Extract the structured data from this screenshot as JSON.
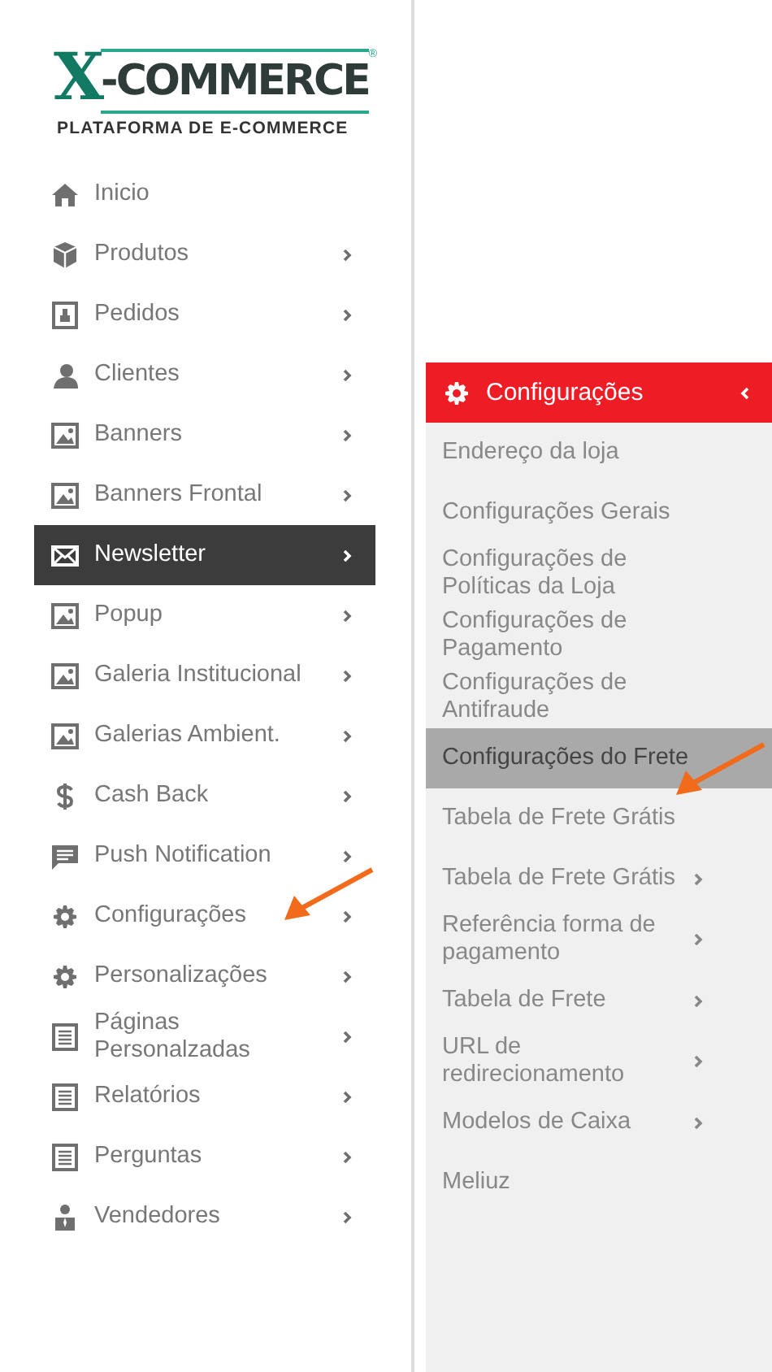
{
  "logo": {
    "mark": "X",
    "word": "-COMMERCE",
    "registered": "®",
    "tagline": "PLATAFORMA DE E-COMMERCE"
  },
  "sidebar": {
    "items": [
      {
        "label": "Inicio",
        "kind": "home",
        "has_children": false,
        "selected": false,
        "marked": false
      },
      {
        "label": "Produtos",
        "kind": "box",
        "has_children": true,
        "selected": false,
        "marked": false
      },
      {
        "label": "Pedidos",
        "kind": "clipboard",
        "has_children": true,
        "selected": false,
        "marked": false
      },
      {
        "label": "Clientes",
        "kind": "user",
        "has_children": true,
        "selected": false,
        "marked": false
      },
      {
        "label": "Banners",
        "kind": "image",
        "has_children": true,
        "selected": false,
        "marked": false
      },
      {
        "label": "Banners Frontal",
        "kind": "image",
        "has_children": true,
        "selected": false,
        "marked": false
      },
      {
        "label": "Newsletter",
        "kind": "mail",
        "has_children": true,
        "selected": true,
        "marked": false
      },
      {
        "label": "Popup",
        "kind": "image",
        "has_children": true,
        "selected": false,
        "marked": false
      },
      {
        "label": "Galeria Institucional",
        "kind": "image",
        "has_children": true,
        "selected": false,
        "marked": false
      },
      {
        "label": "Galerias Ambient.",
        "kind": "image",
        "has_children": true,
        "selected": false,
        "marked": false
      },
      {
        "label": "Cash Back",
        "kind": "dollar",
        "has_children": true,
        "selected": false,
        "marked": false
      },
      {
        "label": "Push Notification",
        "kind": "chat",
        "has_children": true,
        "selected": false,
        "marked": false
      },
      {
        "label": "Configurações",
        "kind": "gear",
        "has_children": true,
        "selected": false,
        "marked": true
      },
      {
        "label": "Personalizações",
        "kind": "gear",
        "has_children": true,
        "selected": false,
        "marked": false
      },
      {
        "label": "Páginas Personalzadas",
        "kind": "page",
        "has_children": true,
        "selected": false,
        "marked": false
      },
      {
        "label": "Relatórios",
        "kind": "page",
        "has_children": true,
        "selected": false,
        "marked": false
      },
      {
        "label": "Perguntas",
        "kind": "page",
        "has_children": true,
        "selected": false,
        "marked": false
      },
      {
        "label": "Vendedores",
        "kind": "person",
        "has_children": true,
        "selected": false,
        "marked": false
      }
    ]
  },
  "submenu": {
    "title": "Configurações",
    "expanded": true,
    "items": [
      {
        "label": "Endereço da loja",
        "has_children": false,
        "selected": false,
        "marked": false
      },
      {
        "label": "Configurações Gerais",
        "has_children": false,
        "selected": false,
        "marked": false
      },
      {
        "label": "Configurações de Políticas da Loja",
        "has_children": false,
        "selected": false,
        "marked": false
      },
      {
        "label": "Configurações de Pagamento",
        "has_children": false,
        "selected": false,
        "marked": false
      },
      {
        "label": "Configurações de Antifraude",
        "has_children": false,
        "selected": false,
        "marked": false
      },
      {
        "label": "Configurações do Frete",
        "has_children": false,
        "selected": true,
        "marked": true
      },
      {
        "label": "Tabela de Frete Grátis",
        "has_children": false,
        "selected": false,
        "marked": false
      },
      {
        "label": "Tabela de Frete Grátis",
        "has_children": true,
        "selected": false,
        "marked": false
      },
      {
        "label": "Referência forma de pagamento",
        "has_children": true,
        "selected": false,
        "marked": false
      },
      {
        "label": "Tabela de Frete",
        "has_children": true,
        "selected": false,
        "marked": false
      },
      {
        "label": "URL de redirecionamento",
        "has_children": true,
        "selected": false,
        "marked": false
      },
      {
        "label": "Modelos de Caixa",
        "has_children": true,
        "selected": false,
        "marked": false
      },
      {
        "label": "Meliuz",
        "has_children": false,
        "selected": false,
        "marked": false
      }
    ]
  }
}
